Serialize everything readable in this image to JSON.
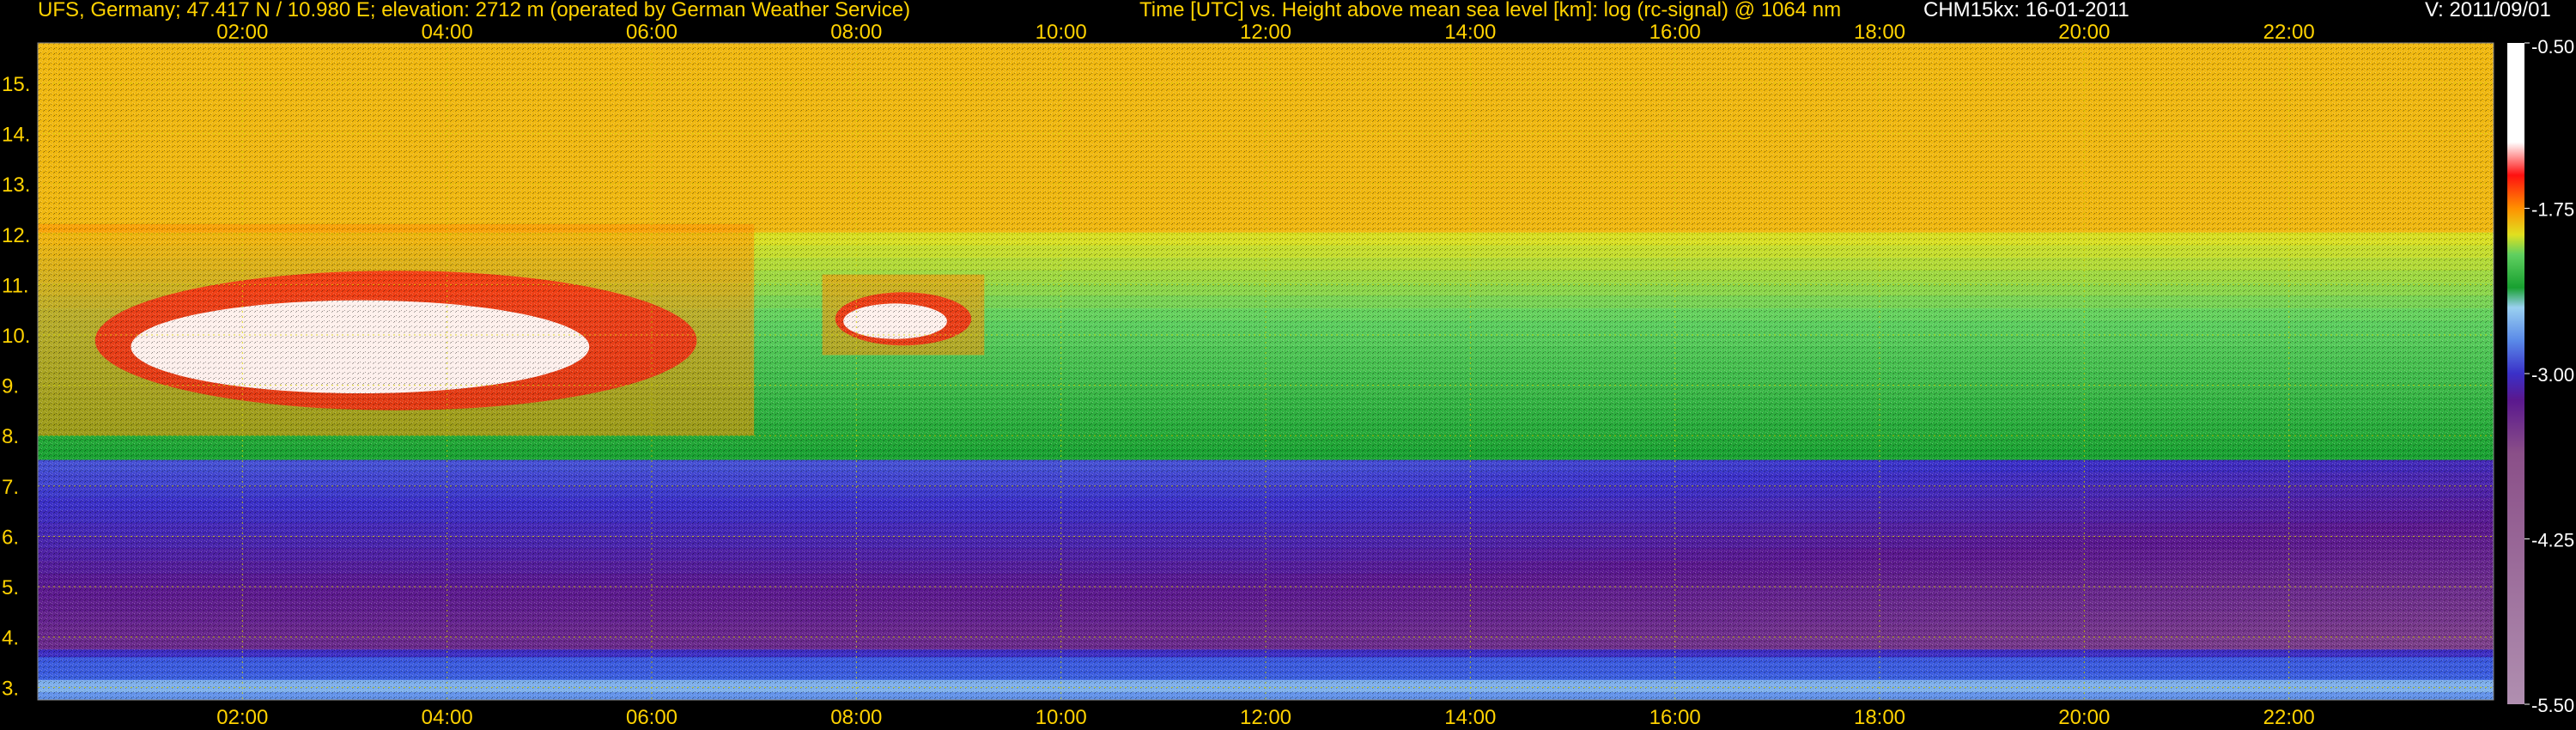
{
  "header": {
    "station": "UFS, Germany; 47.417 N / 10.980 E; elevation: 2712 m  (operated by German Weather Service)",
    "title": "Time [UTC] vs. Height above mean sea level [km]: log (rc-signal) @ 1064 nm",
    "instrument": "CHM15kx: 16-01-2011",
    "version": "V: 2011/09/01"
  },
  "colors": {
    "header_text": "#ffd200",
    "tick_text": "#ffd200",
    "grid": "#d8d800",
    "background": "#000000"
  },
  "chart_data": {
    "type": "heatmap",
    "title": "Time [UTC] vs. Height above mean sea level [km]: log (rc-signal) @ 1064 nm",
    "xlabel": "Time [UTC]",
    "ylabel": "Height above mean sea level [km]",
    "xlim": [
      "00:00",
      "24:00"
    ],
    "ylim": [
      2.75,
      15.8
    ],
    "x_ticks": [
      "02:00",
      "04:00",
      "06:00",
      "08:00",
      "10:00",
      "12:00",
      "14:00",
      "16:00",
      "18:00",
      "20:00",
      "22:00"
    ],
    "x_tick_hours": [
      2,
      4,
      6,
      8,
      10,
      12,
      14,
      16,
      18,
      20,
      22
    ],
    "y_ticks": [
      3,
      4,
      5,
      6,
      7,
      8,
      9,
      10,
      11,
      12,
      13,
      14,
      15
    ],
    "y_tick_labels": [
      "3.",
      "4.",
      "5.",
      "6.",
      "7.",
      "8.",
      "9.",
      "10.",
      "11.",
      "12.",
      "13.",
      "14.",
      "15."
    ],
    "grid": true,
    "colorbar": {
      "label": "log (rc-signal)",
      "range": [
        -5.5,
        -0.5
      ],
      "ticks": [
        -5.5,
        -4.25,
        -3.0,
        -1.75,
        -0.5
      ],
      "tick_labels": [
        "-5.50",
        "-4.25",
        "-3.00",
        "-1.75",
        "-0.50"
      ],
      "colors": [
        {
          "value": -5.5,
          "color": "#b08fb0"
        },
        {
          "value": -3.6,
          "color": "#8a4f88"
        },
        {
          "value": -3.2,
          "color": "#5a188e"
        },
        {
          "value": -3.0,
          "color": "#3a30c8"
        },
        {
          "value": -2.75,
          "color": "#5a8ae8"
        },
        {
          "value": -2.5,
          "color": "#9ad0f0"
        },
        {
          "value": -2.35,
          "color": "#18a030"
        },
        {
          "value": -2.1,
          "color": "#60d060"
        },
        {
          "value": -1.95,
          "color": "#e0e020"
        },
        {
          "value": -1.75,
          "color": "#ff9000"
        },
        {
          "value": -1.5,
          "color": "#ff1010"
        },
        {
          "value": -1.25,
          "color": "#ffffff"
        },
        {
          "value": -0.5,
          "color": "#ffffff"
        }
      ]
    },
    "features": [
      {
        "kind": "cirrus cloud (white/red)",
        "time_start": "00:00",
        "time_end": "07:00",
        "height_base_km": 8.0,
        "height_top_km": 12.2
      },
      {
        "kind": "cirrus cloud (white)",
        "time_start": "07:40",
        "time_end": "09:15",
        "height_base_km": 9.6,
        "height_top_km": 11.2
      },
      {
        "kind": "boundary layer (green/blue)",
        "time_start": "00:00",
        "time_end": "24:00",
        "height_base_km": 2.9,
        "height_top_km": 3.6
      }
    ]
  }
}
